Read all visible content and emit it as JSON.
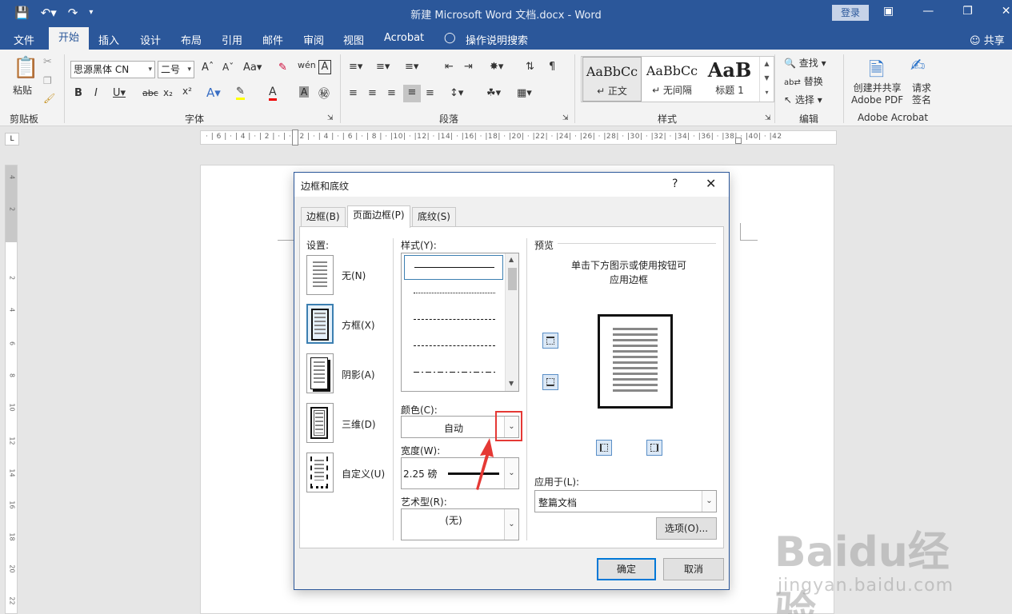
{
  "titlebar": {
    "doc_title": "新建 Microsoft Word 文档.docx  -  Word",
    "login": "登录",
    "save_icon": "save-icon",
    "undo_icon": "undo-icon",
    "redo_icon": "redo-icon"
  },
  "menu": {
    "file": "文件",
    "home": "开始",
    "insert": "插入",
    "design": "设计",
    "layout": "布局",
    "references": "引用",
    "mailings": "邮件",
    "review": "审阅",
    "view": "视图",
    "acrobat": "Acrobat",
    "tell_me": "操作说明搜索",
    "share": "共享"
  },
  "ribbon": {
    "clipboard": {
      "paste": "粘贴",
      "label": "剪贴板"
    },
    "font": {
      "name": "思源黑体 CN",
      "size": "二号",
      "label": "字体"
    },
    "paragraph": {
      "label": "段落"
    },
    "styles": {
      "items": [
        {
          "preview": "AaBbCc",
          "name": "↵ 正文"
        },
        {
          "preview": "AaBbCc",
          "name": "↵ 无间隔"
        },
        {
          "preview": "AaB",
          "name": "标题 1"
        }
      ],
      "label": "样式"
    },
    "editing": {
      "find": "查找",
      "replace": "替换",
      "select": "选择",
      "label": "编辑"
    },
    "acrobat": {
      "create": "创建并共享\nAdobe PDF",
      "request": "请求\n签名",
      "label": "Adobe Acrobat"
    }
  },
  "ruler": {
    "h_ticks": "· | 6 | · | 4 | · | 2 | · | · | 2 | · | 4 | · | 6 | · | 8 | · |10| · |12| · |14| · |16| · |18| · |20| · |22| · |24| · |26| · |28| · |30| · |32| · |34| · |36| · |38| · |40| · |42",
    "corner": "L"
  },
  "dialog": {
    "title": "边框和底纹",
    "help": "?",
    "tabs": {
      "borders": "边框(B)",
      "page_border": "页面边框(P)",
      "shading": "底纹(S)"
    },
    "setting": {
      "label": "设置:",
      "none": "无(N)",
      "box": "方框(X)",
      "shadow": "阴影(A)",
      "threed": "三维(D)",
      "custom": "自定义(U)"
    },
    "style": {
      "label": "样式(Y):"
    },
    "color": {
      "label": "颜色(C):",
      "value": "自动"
    },
    "width": {
      "label": "宽度(W):",
      "value": "2.25 磅"
    },
    "art": {
      "label": "艺术型(R):",
      "value": "(无)"
    },
    "preview": {
      "label": "预览",
      "hint_1": "单击下方图示或使用按钮可",
      "hint_2": "应用边框"
    },
    "apply_to": {
      "label": "应用于(L):",
      "value": "整篇文档"
    },
    "options": "选项(O)...",
    "ok": "确定",
    "cancel": "取消"
  },
  "watermark": {
    "big": "Baidu经验",
    "small": "jingyan.baidu.com"
  }
}
